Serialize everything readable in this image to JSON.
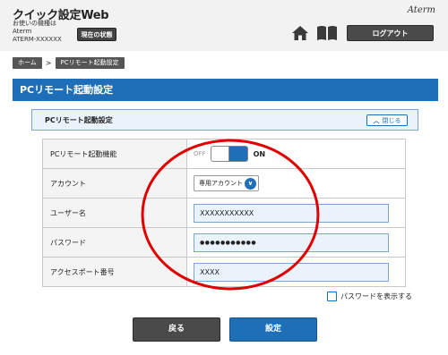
{
  "header": {
    "app_title": "クイック設定Web",
    "device_label": "お使いの機種は",
    "device_brand": "Aterm",
    "device_model": "ATERM-XXXXXX",
    "status_button": "現在の状態",
    "brand_logo": "Aterm",
    "home_icon": "home-icon",
    "manual_icon": "book-icon",
    "logout_button": "ログアウト"
  },
  "breadcrumb": {
    "home": "ホーム",
    "separator": ">",
    "current": "PCリモート起動設定"
  },
  "page": {
    "title": "PCリモート起動設定"
  },
  "panel": {
    "title": "PCリモート起動設定",
    "collapse_label": "閉じる"
  },
  "form": {
    "rows": [
      {
        "label": "PCリモート起動機能",
        "off_label": "OFF",
        "on_label": "ON",
        "state": "ON"
      },
      {
        "label": "アカウント",
        "value": "専用アカウント"
      },
      {
        "label": "ユーザー名",
        "value": "XXXXXXXXXXX"
      },
      {
        "label": "パスワード",
        "value": "●●●●●●●●●●●"
      },
      {
        "label": "アクセスポート番号",
        "value": "XXXX"
      }
    ],
    "show_password_label": "パスワードを表示する"
  },
  "buttons": {
    "back": "戻る",
    "submit": "設定"
  },
  "colors": {
    "accent": "#1f6fb8",
    "annotation": "#e00000",
    "dark_button": "#4a4a4a"
  }
}
